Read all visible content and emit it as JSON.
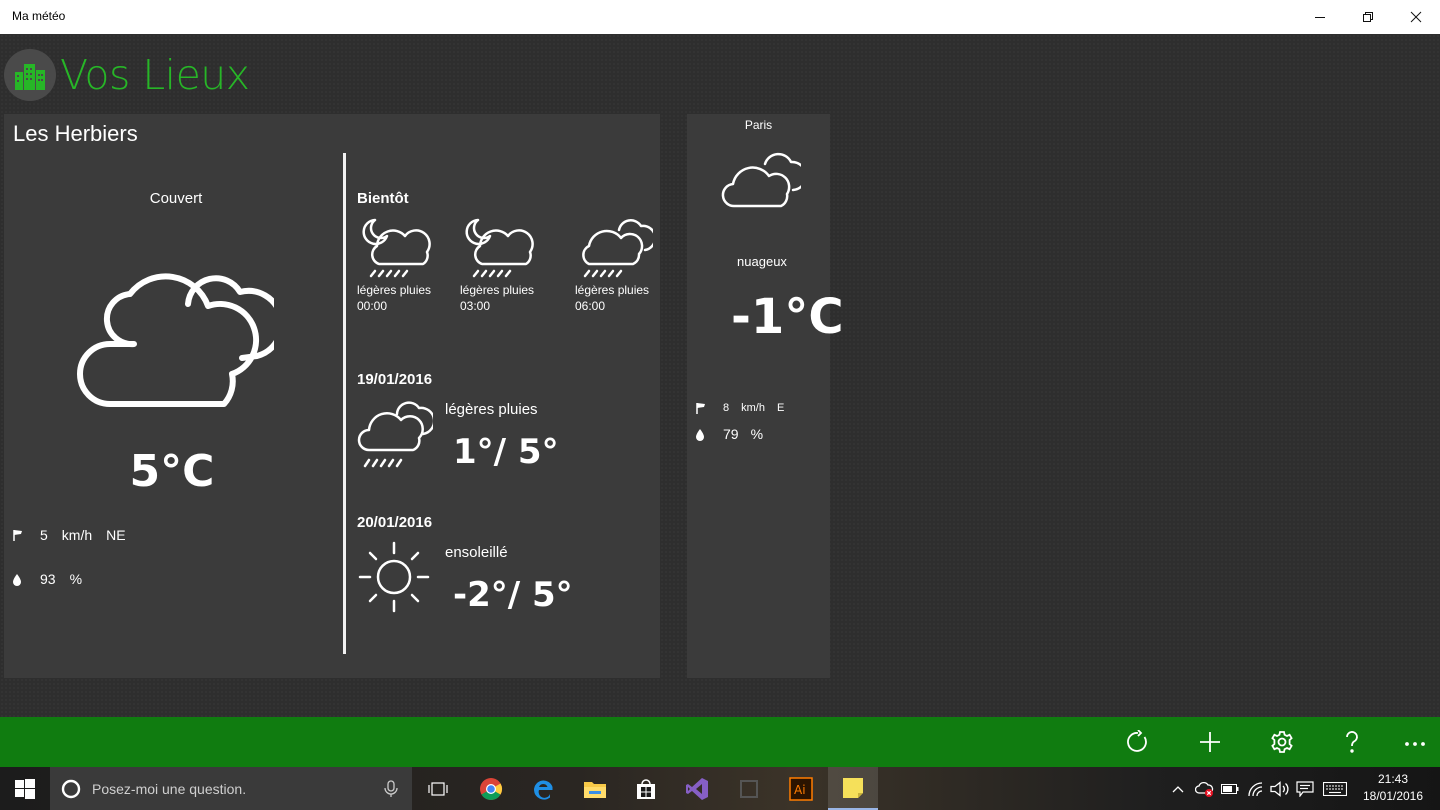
{
  "window": {
    "title": "Ma météo"
  },
  "header": {
    "title": "Vos Lieux"
  },
  "main_location": {
    "city": "Les Herbiers",
    "condition": "Couvert",
    "temperature": "5°C",
    "wind_speed": "5",
    "wind_unit": "km/h",
    "wind_dir": "NE",
    "humidity": "93",
    "humidity_unit": "%",
    "soon_title": "Bientôt",
    "soon": [
      {
        "condition": "légères pluies",
        "time": "00:00",
        "icon": "night-cloud-rain-icon"
      },
      {
        "condition": "légères pluies",
        "time": "03:00",
        "icon": "night-cloud-rain-icon"
      },
      {
        "condition": "légères pluies",
        "time": "06:00",
        "icon": "cloud-rain-icon"
      }
    ],
    "days": [
      {
        "date": "19/01/2016",
        "condition": "légères pluies",
        "range": "1°/ 5°",
        "icon": "cloud-rain-icon"
      },
      {
        "date": "20/01/2016",
        "condition": "ensoleillé",
        "range": "-2°/ 5°",
        "icon": "sun-icon"
      }
    ]
  },
  "secondary_location": {
    "city": "Paris",
    "condition": "nuageux",
    "temperature": "-1°C",
    "wind_speed": "8",
    "wind_unit": "km/h",
    "wind_dir": "E",
    "humidity": "79",
    "humidity_unit": "%"
  },
  "app_bar": {
    "buttons": [
      "refresh-icon",
      "add-icon",
      "settings-icon",
      "help-icon",
      "more-icon"
    ],
    "accent": "#107c10"
  },
  "taskbar": {
    "search_placeholder": "Posez-moi une question.",
    "time": "21:43",
    "date": "18/01/2016"
  },
  "colors": {
    "brand_green": "#27b627",
    "card_bg": "#3b3b3b",
    "app_bg": "#2e2e2e"
  }
}
